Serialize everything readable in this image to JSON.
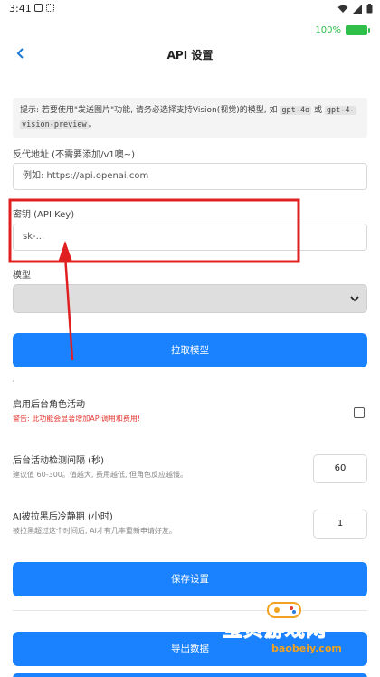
{
  "status_bar": {
    "time": "3:41"
  },
  "battery": {
    "percent_label": "100%",
    "level": 1.0
  },
  "header": {
    "back_icon": "chevron-left-icon",
    "title": "API 设置"
  },
  "tip": {
    "prefix": "提示: 若要使用\"发送图片\"功能, 请务必选择支持Vision(视觉)的模型, 如",
    "code1": "gpt-4o",
    "or": "或",
    "code2": "gpt-4-",
    "code2b": "vision-preview",
    "suffix": "。"
  },
  "proxy": {
    "label": "反代地址 (不需要添加/v1噢~)",
    "placeholder": "例如: https://api.openai.com"
  },
  "api_key": {
    "label": "密钥 (API Key)",
    "placeholder": "sk-..."
  },
  "model": {
    "label": "模型",
    "selected": ""
  },
  "fetch_models_button": "拉取模型",
  "background_activity": {
    "title": "启用后台角色活动",
    "warning": "警告: 此功能会显著增加API调用和费用!",
    "checked": false
  },
  "check_interval": {
    "title": "后台活动检测间隔 (秒)",
    "hint": "建议值 60-300。值越大, 费用越低, 但角色反应越慢。",
    "value": "60"
  },
  "cooldown": {
    "title": "AI被拉黑后冷静期 (小时)",
    "hint": "被拉黑超过这个时间后, AI才有几率重新申请好友。",
    "value": "1"
  },
  "save_button": "保存设置",
  "export_button": "导出数据",
  "watermark": {
    "main": "宝贝游戏网",
    "sub": "baobeiy.com"
  },
  "colors": {
    "accent": "#1a82ff",
    "warning": "#e53935",
    "annotation": "#e02020",
    "battery": "#2fbf4a"
  }
}
